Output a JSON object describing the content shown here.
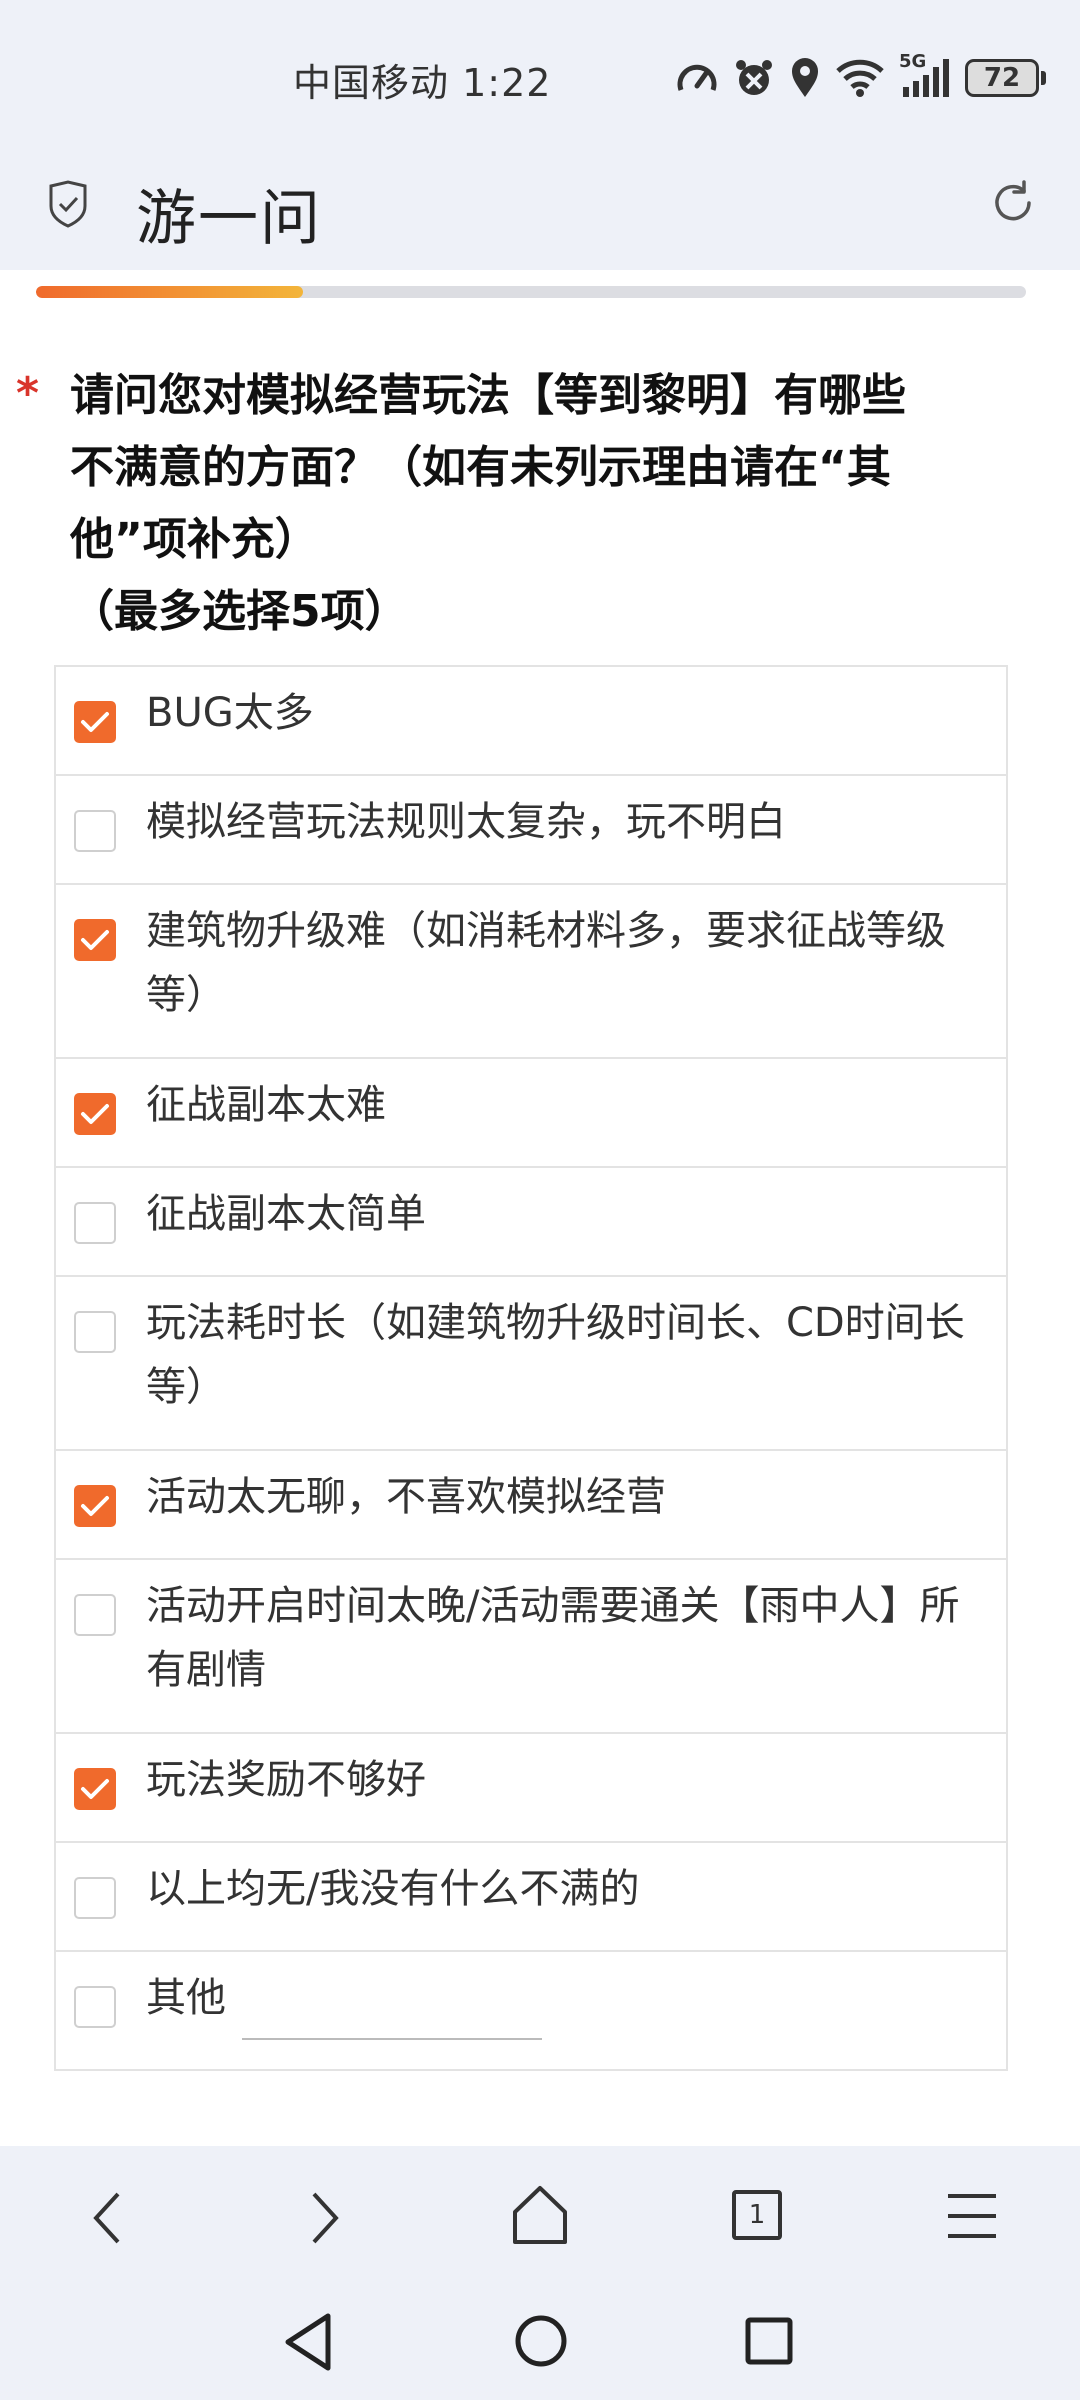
{
  "status_bar": {
    "carrier": "中国移动",
    "time": "1:22",
    "network": "5G",
    "battery": "72"
  },
  "header": {
    "title": "游一问"
  },
  "progress": {
    "fraction": 0.27
  },
  "question": {
    "required_mark": "*",
    "line1": "请问您对模拟经营玩法【等到黎明】有哪些",
    "line2": "不满意的方面？（如有未列示理由请在“其",
    "line3": "他”项补充）",
    "line4": "（最多选择5项）"
  },
  "options": [
    {
      "label": "BUG太多",
      "checked": true
    },
    {
      "label": "模拟经营玩法规则太复杂，玩不明白",
      "checked": false
    },
    {
      "label": "建筑物升级难（如消耗材料多，要求征战等级等）",
      "checked": true
    },
    {
      "label": "征战副本太难",
      "checked": true
    },
    {
      "label": "征战副本太简单",
      "checked": false
    },
    {
      "label": "玩法耗时长（如建筑物升级时间长、CD时间长等）",
      "checked": false
    },
    {
      "label": "活动太无聊，不喜欢模拟经营",
      "checked": true
    },
    {
      "label": "活动开启时间太晚/活动需要通关【雨中人】所有剧情",
      "checked": false
    },
    {
      "label": "玩法奖励不够好",
      "checked": true
    },
    {
      "label": "以上均无/我没有什么不满的",
      "checked": false
    },
    {
      "label": "其他",
      "checked": false
    }
  ],
  "browser_nav": {
    "tab_count": "1"
  },
  "colors": {
    "accent": "#f06a2c",
    "required": "#d9342b",
    "bar_bg": "#eef1f8"
  }
}
